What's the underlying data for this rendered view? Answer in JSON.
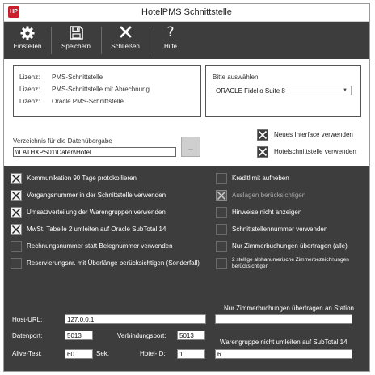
{
  "window": {
    "title": "HotelPMS Schnittstelle",
    "app_icon_text": "HP"
  },
  "toolbar": {
    "buttons": [
      {
        "label": "Einstellen",
        "icon": "gear-icon"
      },
      {
        "label": "Speichern",
        "icon": "floppy-disk-icon"
      },
      {
        "label": "Schließen",
        "icon": "close-icon"
      },
      {
        "label": "Hilfe",
        "icon": "question-mark-icon"
      }
    ]
  },
  "licenses": [
    {
      "key": "Lizenz:",
      "value": "PMS-Schnittstelle"
    },
    {
      "key": "Lizenz:",
      "value": "PMS-Schnittstelle mit Abrechnung"
    },
    {
      "key": "Lizenz:",
      "value": "Oracle PMS-Schnittstelle"
    }
  ],
  "selection": {
    "label": "Bitte auswählen",
    "value": "ORACLE Fidelio Suite 8"
  },
  "directory": {
    "label": "Verzeichnis für die Datenübergabe",
    "value": "\\\\LATHXPS01\\Daten\\Hotel",
    "browse_label": "..."
  },
  "top_checks": [
    {
      "label": "Neues Interface verwenden",
      "checked": true
    },
    {
      "label": "Hotelschnittstelle verwenden",
      "checked": true
    }
  ],
  "left_checks": [
    {
      "label": "Kommunikation 90 Tage protokollieren",
      "checked": true
    },
    {
      "label": "Vorgangsnummer in der Schnittstelle verwenden",
      "checked": true
    },
    {
      "label": "Umsatzverteilung der Warengruppen verwenden",
      "checked": true
    },
    {
      "label": "MwSt. Tabelle 2 umleiten auf Oracle SubTotal 14",
      "checked": true
    },
    {
      "label": "Rechnungsnummer statt Belegnummer verwenden",
      "checked": false
    },
    {
      "label": "Reservierungsnr. mit Überlänge berücksichtigen (Sonderfall)",
      "checked": false
    }
  ],
  "right_checks": [
    {
      "label": "Kreditlimit aufheben",
      "checked": false
    },
    {
      "label": "Auslagen berücksichtigen",
      "checked": true
    },
    {
      "label": "Hinweise nicht anzeigen",
      "checked": false
    },
    {
      "label": "Schnittstellennummer verwenden",
      "checked": false
    },
    {
      "label": "Nur Zimmerbuchungen übertragen (alle)",
      "checked": false
    },
    {
      "label": "2 stellige alphanumerische Zimmerbezeichnungen berücksichtigen",
      "checked": false
    }
  ],
  "fields": {
    "host_url": {
      "label": "Host-URL:",
      "value": "127.0.0.1"
    },
    "datenport": {
      "label": "Datenport:",
      "value": "5013"
    },
    "verbindungsport": {
      "label": "Verbindungsport:",
      "value": "5013"
    },
    "alive_test": {
      "label": "Alive-Test:",
      "value": "60",
      "unit": "Sek."
    },
    "hotel_id": {
      "label": "Hotel-ID:",
      "value": "1"
    },
    "station": {
      "label": "Nur Zimmerbuchungen übertragen an Station",
      "value": ""
    },
    "warengruppe": {
      "label": "Warengruppe nicht umleiten auf SubTotal 14",
      "value": "6"
    }
  }
}
